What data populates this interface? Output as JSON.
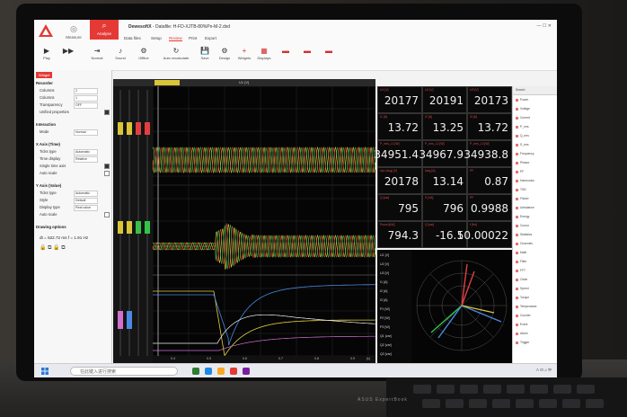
{
  "app": {
    "title_app": "DewesoftX",
    "title_file": "- Datafile: H-FD-XJTB-80%Pn-M-2.dxd",
    "tab_measure": "Measure",
    "tab_analyse": "Analyse",
    "menu": [
      "Data files",
      "Setup",
      "Review",
      "Print",
      "Export"
    ],
    "window_controls": "— ☐ ✕"
  },
  "toolbar": [
    {
      "label": "Play",
      "icon": "▶"
    },
    {
      "label": "",
      "icon": "▶▶"
    },
    {
      "label": "Normal",
      "icon": "⇥"
    },
    {
      "label": "Sound",
      "icon": "♪"
    },
    {
      "label": "Offline",
      "icon": "⚙"
    },
    {
      "label": "Auto recalculate",
      "icon": "↻"
    },
    {
      "label": "Save",
      "icon": "💾"
    },
    {
      "label": "Design",
      "icon": "⚙"
    },
    {
      "label": "Widgets",
      "icon": "+"
    },
    {
      "label": "Displays",
      "icon": "▦"
    }
  ],
  "left_panel": {
    "tab": "Widget",
    "recorder": "Recorder",
    "rows": [
      {
        "label": "Columns",
        "value": "2"
      },
      {
        "label": "Columns",
        "value": "1"
      },
      {
        "label": "Transparency",
        "value": "OFF"
      },
      {
        "label": "Unified properties",
        "value": ""
      }
    ],
    "interaction": "Interaction",
    "mode_label": "Mode",
    "mode_value": "Normal",
    "x_axis": "X Axis (Time)",
    "x_rows": [
      {
        "label": "Ticks type",
        "value": "Automatic"
      },
      {
        "label": "Time display",
        "value": "Relative"
      },
      {
        "label": "Single time axis",
        "value": ""
      },
      {
        "label": "Auto scale",
        "value": ""
      }
    ],
    "y_axis": "Y Axis (Value)",
    "y_rows": [
      {
        "label": "Ticks type",
        "value": "Automatic"
      },
      {
        "label": "Style",
        "value": "Default"
      },
      {
        "label": "Display type",
        "value": "Real value"
      },
      {
        "label": "Auto scale",
        "value": ""
      }
    ],
    "drawing": "Drawing options",
    "cursor": "dt = 522.72 ms   f = 1.91 Hz"
  },
  "plot": {
    "header": "U1 [V]",
    "xticks": [
      "0.4",
      "0.5",
      "0.6",
      "0.7",
      "0.8",
      "0.9"
    ],
    "xlabel": "[s]"
  },
  "readings": [
    {
      "label": "U1 [V]",
      "value": "20177"
    },
    {
      "label": "U2 [V]",
      "value": "20191"
    },
    {
      "label": "U3 [V]",
      "value": "20173"
    },
    {
      "label": "I1 [A]",
      "value": "13.72"
    },
    {
      "label": "I2 [A]",
      "value": "13.25"
    },
    {
      "label": "I3 [A]",
      "value": "13.72"
    },
    {
      "label": "P_rms_L1 [W]",
      "value": "34951.4"
    },
    {
      "label": "P_rms_L2 [W]",
      "value": "34967.9"
    },
    {
      "label": "P_rms_L3 [W]",
      "value": "34938.8"
    },
    {
      "label": "Upr (avg) [V]",
      "value": "20178"
    },
    {
      "label": "Iavg [A]",
      "value": "13.14"
    },
    {
      "label": "PF",
      "value": "0.87"
    },
    {
      "label": "Q [var]",
      "value": "795"
    },
    {
      "label": "S [VA]",
      "value": "796"
    },
    {
      "label": "PF",
      "value": "0.9988"
    },
    {
      "label": "Psum [kW]",
      "value": "794.3"
    },
    {
      "label": "Q [var]",
      "value": "-16.1"
    },
    {
      "label": "f [Hz]",
      "value": "50.00022"
    }
  ],
  "signals": [
    "U1 [V]",
    "U2 [V]",
    "U3 [V]",
    "I1 [A]",
    "I2 [A]",
    "I3 [A]",
    "P1 [W]",
    "P2 [W]",
    "P3 [W]",
    "Q1 [var]",
    "Q2 [var]",
    "Q3 [var]"
  ],
  "right_panel": {
    "header": "Search",
    "items": [
      "Power",
      "Voltage",
      "Current",
      "P_rms",
      "Q_rms",
      "S_rms",
      "Frequency",
      "Phasor",
      "PF",
      "Harmonics",
      "THD",
      "Flicker",
      "Unbalance",
      "Energy",
      "Cursor",
      "Statistics",
      "Channels",
      "Math",
      "Filter",
      "FFT",
      "Order",
      "Speed",
      "Torque",
      "Temperature",
      "Counter",
      "Event",
      "Alarm",
      "Trigger"
    ]
  },
  "taskbar": {
    "search_placeholder": "在此键入进行搜索"
  },
  "hardware": {
    "brand": "ASUS ExpertBook"
  },
  "colors": {
    "accent": "#e53935",
    "yellow": "#e8d23c",
    "green": "#35c24a",
    "red": "#e04040"
  }
}
